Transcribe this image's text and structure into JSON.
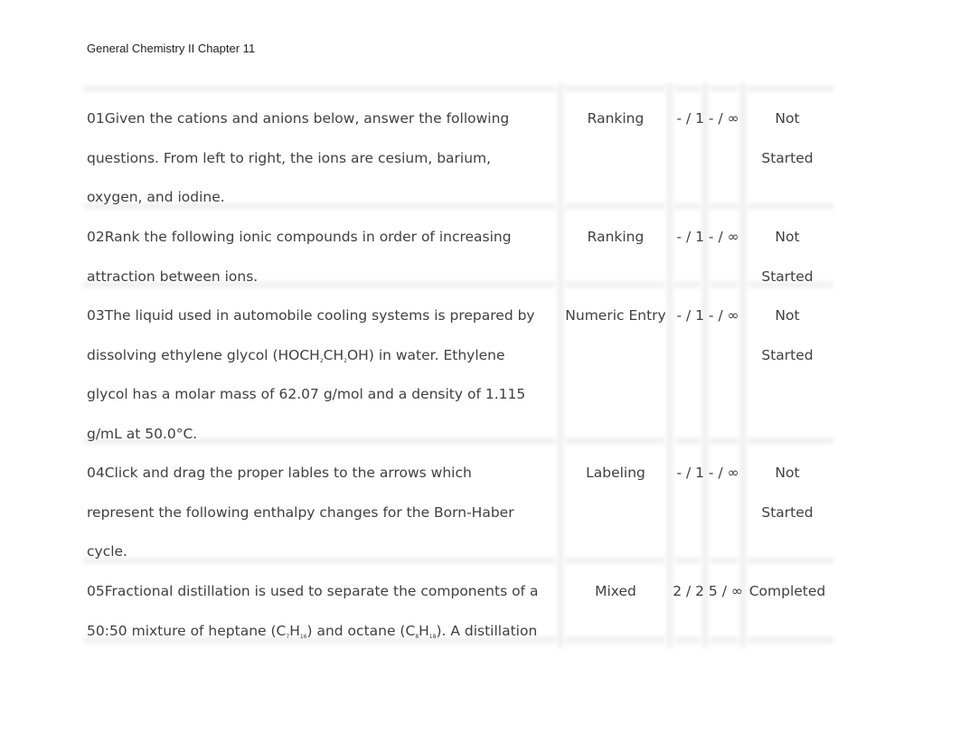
{
  "header": {
    "title": "General Chemistry II Chapter 11"
  },
  "rows": [
    {
      "lines": [
        [
          {
            "t": "01Given the cations and anions below, answer the following"
          }
        ],
        [
          {
            "t": "questions. From left to right, the ions are cesium, barium,"
          }
        ],
        [
          {
            "t": "oxygen, and iodine."
          }
        ]
      ],
      "type": "Ranking",
      "score": "- / 1 - / ∞",
      "status": [
        "Not",
        "Started"
      ]
    },
    {
      "lines": [
        [
          {
            "t": "02Rank the following ionic compounds in order of increasing"
          }
        ],
        [
          {
            "t": "attraction between ions."
          }
        ]
      ],
      "type": "Ranking",
      "score": "- / 1 - / ∞",
      "status": [
        "Not",
        "Started"
      ]
    },
    {
      "lines": [
        [
          {
            "t": "03The liquid used in automobile cooling systems is prepared by"
          }
        ],
        [
          {
            "t": "dissolving ethylene glycol (HOCH"
          },
          {
            "sub": "2"
          },
          {
            "t": "CH"
          },
          {
            "sub": "2"
          },
          {
            "t": "OH) in water. Ethylene"
          }
        ],
        [
          {
            "t": "glycol has a molar mass of 62.07 g/mol and a density of 1.115"
          }
        ],
        [
          {
            "t": "g/mL at 50.0°C."
          }
        ]
      ],
      "type": "Numeric Entry",
      "score": "- / 1 - / ∞",
      "status": [
        "Not",
        "Started"
      ]
    },
    {
      "lines": [
        [
          {
            "t": "04Click and drag the proper lables to the arrows which"
          }
        ],
        [
          {
            "t": "represent the following enthalpy changes for the Born-Haber"
          }
        ],
        [
          {
            "t": "cycle."
          }
        ]
      ],
      "type": "Labeling",
      "score": "- / 1 - / ∞",
      "status": [
        "Not",
        "Started"
      ]
    },
    {
      "lines": [
        [
          {
            "t": "05Fractional distillation is used to separate the components of a"
          }
        ],
        [
          {
            "t": "50:50 mixture of heptane (C"
          },
          {
            "sub": "7"
          },
          {
            "t": "H"
          },
          {
            "sub": "16"
          },
          {
            "t": ") and octane (C"
          },
          {
            "sub": "8"
          },
          {
            "t": "H"
          },
          {
            "sub": "18"
          },
          {
            "t": "). A distillation"
          }
        ]
      ],
      "type": "Mixed",
      "score": "2 / 2 5 / ∞",
      "status": [
        "Completed"
      ]
    }
  ]
}
